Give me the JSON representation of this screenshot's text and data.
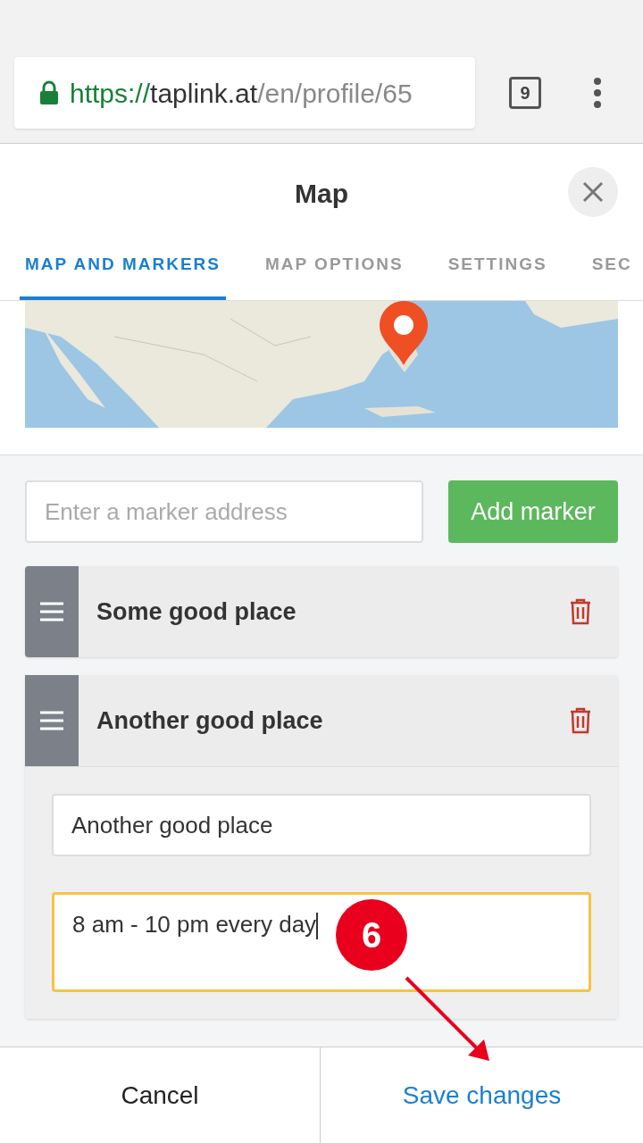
{
  "browser": {
    "url_scheme": "https://",
    "url_host": "taplink.at",
    "url_path": "/en/profile/65",
    "tab_count": "9"
  },
  "dialog": {
    "title": "Map",
    "tabs": [
      {
        "label": "MAP AND MARKERS",
        "selected": true
      },
      {
        "label": "MAP OPTIONS",
        "selected": false
      },
      {
        "label": "SETTINGS",
        "selected": false
      },
      {
        "label": "SEC",
        "selected": false
      }
    ]
  },
  "marker_input": {
    "placeholder": "Enter a marker address"
  },
  "add_button": "Add marker",
  "markers": [
    {
      "title": "Some good place",
      "expanded": false
    },
    {
      "title": "Another good place",
      "expanded": true,
      "name_value": "Another good place",
      "description_value": "8 am - 10 pm every day",
      "description_focused": true
    }
  ],
  "footer": {
    "cancel": "Cancel",
    "save": "Save changes"
  },
  "annotation": {
    "step": "6"
  }
}
